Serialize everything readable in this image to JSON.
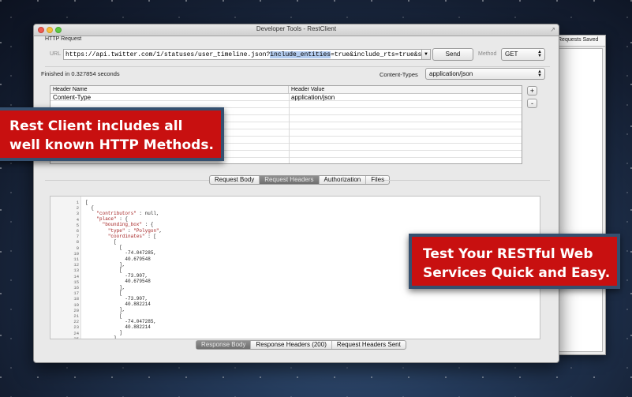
{
  "window": {
    "title": "Developer Tools - RestClient"
  },
  "side_panel": {
    "title": "Requests Saved"
  },
  "request": {
    "section_label": "HTTP Request",
    "url_label": "URL",
    "url_before": "https://api.twitter.com/1/statuses/user_timeline.json?",
    "url_selected": "include_entities",
    "url_after": "=true&include_rts=true&screen_name",
    "send_label": "Send",
    "method_label": "Method",
    "method_value": "GET"
  },
  "status": {
    "finished_text": "Finished in 0.327854 seconds",
    "content_types_label": "Content-Types",
    "content_types_value": "application/json"
  },
  "headers_table": {
    "col_name": "Header Name",
    "col_value": "Header Value",
    "rows": [
      {
        "name": "Content-Type",
        "value": "application/json"
      }
    ],
    "add_label": "+",
    "remove_label": "-"
  },
  "request_tabs": [
    "Request Body",
    "Request Headers",
    "Authorization",
    "Files"
  ],
  "request_tab_selected": "Request Headers",
  "response_tabs": [
    "Response Body",
    "Response Headers (200)",
    "Request Headers Sent"
  ],
  "response_tab_selected": "Response Body",
  "code_lines": [
    "[",
    "  {",
    "    \"contributors\" : null,",
    "    \"place\" : {",
    "      \"bounding_box\" : {",
    "        \"type\" : \"Polygon\",",
    "        \"coordinates\" : [",
    "          [",
    "            [",
    "              -74.047285,",
    "              40.679548",
    "            ],",
    "            [",
    "              -73.907,",
    "              40.679548",
    "            ],",
    "            [",
    "              -73.907,",
    "              40.882214",
    "            ],",
    "            [",
    "              -74.047285,",
    "              40.882214",
    "            ]",
    "          ]"
  ],
  "callouts": {
    "left_line1": "Rest Client includes all",
    "left_line2": "well known HTTP Methods.",
    "right_line1": "Test Your RESTful Web",
    "right_line2": "Services Quick and Easy."
  },
  "colors": {
    "callout_red": "#c81010",
    "callout_border": "#35506f",
    "selection": "#b4cdf0"
  }
}
